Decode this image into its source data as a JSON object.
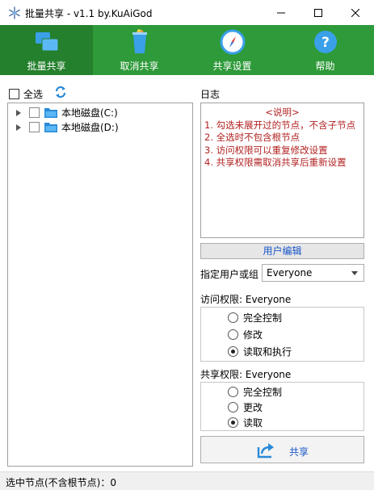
{
  "window": {
    "title": "批量共享 - v1.1 by.KuAiGod",
    "controls": {
      "minimize": "minimize",
      "maximize": "maximize",
      "close": "close"
    }
  },
  "toolbar": {
    "buttons": [
      {
        "label": "批量共享",
        "icon": "batch-share-icon",
        "active": true
      },
      {
        "label": "取消共享",
        "icon": "recycle-bin-icon",
        "active": false
      },
      {
        "label": "共享设置",
        "icon": "compass-icon",
        "active": false
      },
      {
        "label": "帮助",
        "icon": "help-icon",
        "active": false
      }
    ],
    "background": "#2e9a39",
    "active_background": "#24802d"
  },
  "left_pane": {
    "select_all_label": "全选",
    "refresh_icon": "refresh-icon",
    "tree": [
      {
        "label": "本地磁盘(C:)",
        "checked": false
      },
      {
        "label": "本地磁盘(D:)",
        "checked": false
      }
    ]
  },
  "log": {
    "title": "日志",
    "heading": "<说明>",
    "lines": [
      "1. 勾选未展开过的节点，不含子节点",
      "2. 全选时不包含根节点",
      "3. 访问权限可以重复修改设置",
      "4. 共享权限需取消共享后重新设置"
    ],
    "color": "#b22222"
  },
  "user_edit_button": "用户编辑",
  "user_group": {
    "label": "指定用户或组",
    "selected": "Everyone"
  },
  "access_permission": {
    "title": "访问权限: Everyone",
    "options": [
      {
        "label": "完全控制",
        "checked": false
      },
      {
        "label": "修改",
        "checked": false
      },
      {
        "label": "读取和执行",
        "checked": true
      }
    ]
  },
  "share_permission": {
    "title": "共享权限: Everyone",
    "options": [
      {
        "label": "完全控制",
        "checked": false
      },
      {
        "label": "更改",
        "checked": false
      },
      {
        "label": "读取",
        "checked": true
      }
    ]
  },
  "share_button": {
    "label": "共享",
    "icon": "share-arrow-icon"
  },
  "status": {
    "text": "选中节点(不含根节点)：0"
  }
}
